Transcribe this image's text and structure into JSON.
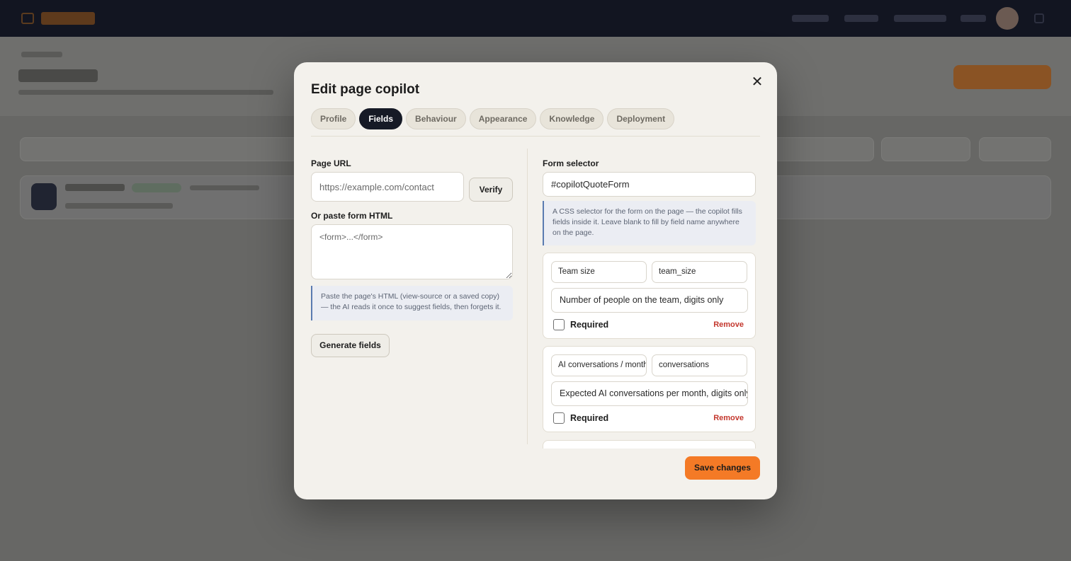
{
  "modal": {
    "title": "Edit page copilot",
    "close_icon": "close-icon",
    "tabs": [
      {
        "label": "Profile",
        "active": false
      },
      {
        "label": "Fields",
        "active": true
      },
      {
        "label": "Behaviour",
        "active": false
      },
      {
        "label": "Appearance",
        "active": false
      },
      {
        "label": "Knowledge",
        "active": false
      },
      {
        "label": "Deployment",
        "active": false
      }
    ],
    "left": {
      "page_url_label": "Page URL",
      "page_url_placeholder": "https://example.com/contact",
      "page_url_value": "",
      "verify_label": "Verify",
      "html_label": "Or paste form HTML",
      "html_placeholder": "<form>...</form>",
      "html_note": "Paste the page's HTML (view-source or a saved copy) — the AI reads it once to suggest fields, then forgets it.",
      "generate_label": "Generate fields"
    },
    "right": {
      "form_selector_label": "Form selector",
      "form_selector_value": "#copilotQuoteForm",
      "form_selector_note": "A CSS selector for the form on the page — the copilot fills fields inside it. Leave blank to fill by field name anywhere on the page.",
      "fields": [
        {
          "label": "Team size",
          "name": "team_size",
          "description": "Number of people on the team, digits only",
          "required_label": "Required",
          "required": false,
          "remove_label": "Remove"
        },
        {
          "label": "AI conversations / month",
          "name": "conversations",
          "description": "Expected AI conversations per month, digits only",
          "required_label": "Required",
          "required": false,
          "remove_label": "Remove"
        }
      ]
    },
    "save_label": "Save changes"
  },
  "colors": {
    "accent": "#f47a26",
    "active_tab": "#161a26",
    "remove": "#c4382e",
    "note_border": "#5a7bb0"
  }
}
